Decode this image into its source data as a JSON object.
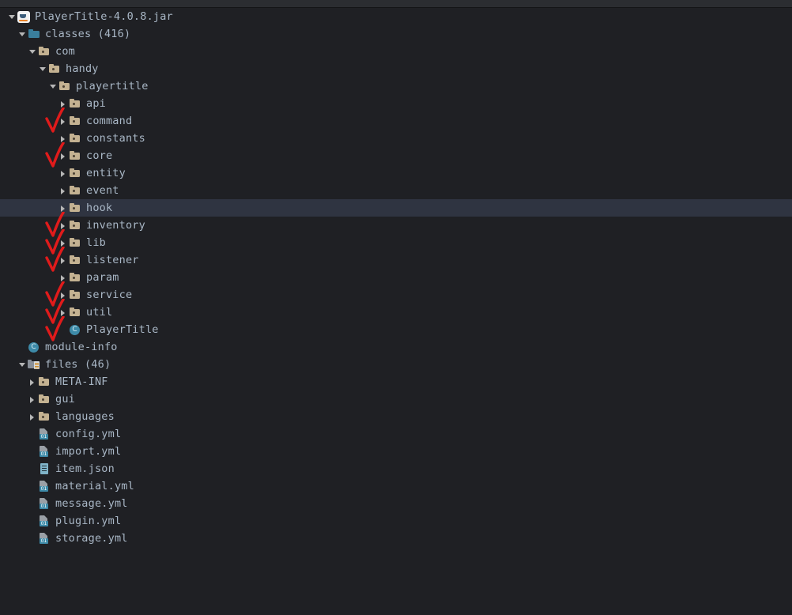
{
  "window": {
    "title": "PlayerTitle-4.0.8.jar"
  },
  "colors": {
    "background": "#1f2024",
    "titlebar": "#2b2d31",
    "selection": "#2f3441",
    "text": "#a9b7c6",
    "checkmark": "#e01b1b",
    "folder": "#c4b292",
    "folder_teal": "#3a7e9c",
    "class_icon": "#3d8aa8"
  },
  "icons": {
    "jar": "jar-icon",
    "folder": "folder-icon",
    "folder_classes": "classes-folder-icon",
    "folder_resources": "resources-folder-icon",
    "class_file": "class-file-icon",
    "yml_file": "yaml-file-icon",
    "json_file": "json-file-icon",
    "arrow_expanded": "chevron-down-icon",
    "arrow_collapsed": "chevron-right-icon",
    "check": "red-check-annotation"
  },
  "tree": [
    {
      "label": "PlayerTitle-4.0.8.jar",
      "depth": 0,
      "icon": "jar",
      "arrow": "expanded",
      "checked": false,
      "selected": false,
      "name": "tree-item-playertitle-jar"
    },
    {
      "label": "classes (416)",
      "depth": 1,
      "icon": "folder-teal",
      "arrow": "expanded",
      "checked": false,
      "selected": false,
      "name": "tree-item-classes"
    },
    {
      "label": "com",
      "depth": 2,
      "icon": "folder",
      "arrow": "expanded",
      "checked": false,
      "selected": false,
      "name": "tree-item-com"
    },
    {
      "label": "handy",
      "depth": 3,
      "icon": "folder",
      "arrow": "expanded",
      "checked": false,
      "selected": false,
      "name": "tree-item-handy"
    },
    {
      "label": "playertitle",
      "depth": 4,
      "icon": "folder",
      "arrow": "expanded",
      "checked": false,
      "selected": false,
      "name": "tree-item-playertitle"
    },
    {
      "label": "api",
      "depth": 5,
      "icon": "folder",
      "arrow": "collapsed",
      "checked": false,
      "selected": false,
      "name": "tree-item-api"
    },
    {
      "label": "command",
      "depth": 5,
      "icon": "folder",
      "arrow": "collapsed",
      "checked": true,
      "selected": false,
      "name": "tree-item-command"
    },
    {
      "label": "constants",
      "depth": 5,
      "icon": "folder",
      "arrow": "collapsed",
      "checked": false,
      "selected": false,
      "name": "tree-item-constants"
    },
    {
      "label": "core",
      "depth": 5,
      "icon": "folder",
      "arrow": "collapsed",
      "checked": true,
      "selected": false,
      "name": "tree-item-core"
    },
    {
      "label": "entity",
      "depth": 5,
      "icon": "folder",
      "arrow": "collapsed",
      "checked": false,
      "selected": false,
      "name": "tree-item-entity"
    },
    {
      "label": "event",
      "depth": 5,
      "icon": "folder",
      "arrow": "collapsed",
      "checked": false,
      "selected": false,
      "name": "tree-item-event"
    },
    {
      "label": "hook",
      "depth": 5,
      "icon": "folder",
      "arrow": "collapsed",
      "checked": false,
      "selected": true,
      "name": "tree-item-hook"
    },
    {
      "label": "inventory",
      "depth": 5,
      "icon": "folder",
      "arrow": "collapsed",
      "checked": true,
      "selected": false,
      "name": "tree-item-inventory"
    },
    {
      "label": "lib",
      "depth": 5,
      "icon": "folder",
      "arrow": "collapsed",
      "checked": true,
      "selected": false,
      "name": "tree-item-lib"
    },
    {
      "label": "listener",
      "depth": 5,
      "icon": "folder",
      "arrow": "collapsed",
      "checked": true,
      "selected": false,
      "name": "tree-item-listener"
    },
    {
      "label": "param",
      "depth": 5,
      "icon": "folder",
      "arrow": "collapsed",
      "checked": false,
      "selected": false,
      "name": "tree-item-param"
    },
    {
      "label": "service",
      "depth": 5,
      "icon": "folder",
      "arrow": "collapsed",
      "checked": true,
      "selected": false,
      "name": "tree-item-service"
    },
    {
      "label": "util",
      "depth": 5,
      "icon": "folder",
      "arrow": "collapsed",
      "checked": true,
      "selected": false,
      "name": "tree-item-util"
    },
    {
      "label": "PlayerTitle",
      "depth": 5,
      "icon": "class",
      "arrow": "none",
      "checked": true,
      "selected": false,
      "name": "tree-item-playertitle-class"
    },
    {
      "label": "module-info",
      "depth": 1,
      "icon": "class",
      "arrow": "none",
      "checked": false,
      "selected": false,
      "name": "tree-item-module-info"
    },
    {
      "label": "files (46)",
      "depth": 1,
      "icon": "folder-res",
      "arrow": "expanded",
      "checked": false,
      "selected": false,
      "name": "tree-item-files"
    },
    {
      "label": "META-INF",
      "depth": 2,
      "icon": "folder",
      "arrow": "collapsed",
      "checked": false,
      "selected": false,
      "name": "tree-item-meta-inf"
    },
    {
      "label": "gui",
      "depth": 2,
      "icon": "folder",
      "arrow": "collapsed",
      "checked": false,
      "selected": false,
      "name": "tree-item-gui"
    },
    {
      "label": "languages",
      "depth": 2,
      "icon": "folder",
      "arrow": "collapsed",
      "checked": false,
      "selected": false,
      "name": "tree-item-languages"
    },
    {
      "label": "config.yml",
      "depth": 2,
      "icon": "yml",
      "arrow": "none",
      "checked": false,
      "selected": false,
      "name": "tree-item-config-yml"
    },
    {
      "label": "import.yml",
      "depth": 2,
      "icon": "yml",
      "arrow": "none",
      "checked": false,
      "selected": false,
      "name": "tree-item-import-yml"
    },
    {
      "label": "item.json",
      "depth": 2,
      "icon": "json",
      "arrow": "none",
      "checked": false,
      "selected": false,
      "name": "tree-item-item-json"
    },
    {
      "label": "material.yml",
      "depth": 2,
      "icon": "yml",
      "arrow": "none",
      "checked": false,
      "selected": false,
      "name": "tree-item-material-yml"
    },
    {
      "label": "message.yml",
      "depth": 2,
      "icon": "yml",
      "arrow": "none",
      "checked": false,
      "selected": false,
      "name": "tree-item-message-yml"
    },
    {
      "label": "plugin.yml",
      "depth": 2,
      "icon": "yml",
      "arrow": "none",
      "checked": false,
      "selected": false,
      "name": "tree-item-plugin-yml"
    },
    {
      "label": "storage.yml",
      "depth": 2,
      "icon": "yml",
      "arrow": "none",
      "checked": false,
      "selected": false,
      "name": "tree-item-storage-yml"
    }
  ],
  "yml_badge_text": "01"
}
